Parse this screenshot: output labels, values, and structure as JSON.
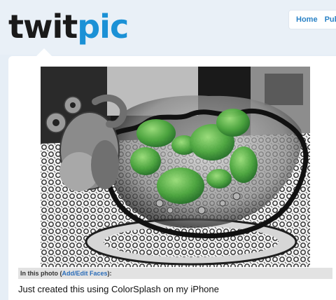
{
  "logo": {
    "part1": "twit",
    "part2": "pic"
  },
  "nav": {
    "items": [
      "Home",
      "Public"
    ]
  },
  "photo": {
    "alt": "Frog planter with water lettuce on a lace doily"
  },
  "faces": {
    "label": "In this photo",
    "open_paren": " (",
    "link": "Add/Edit Faces",
    "close": "):"
  },
  "caption": "Just created this using ColorSplash on my iPhone",
  "colors": {
    "brand_blue": "#1b91d6",
    "link": "#2a82c6",
    "background": "#e6eef6"
  }
}
